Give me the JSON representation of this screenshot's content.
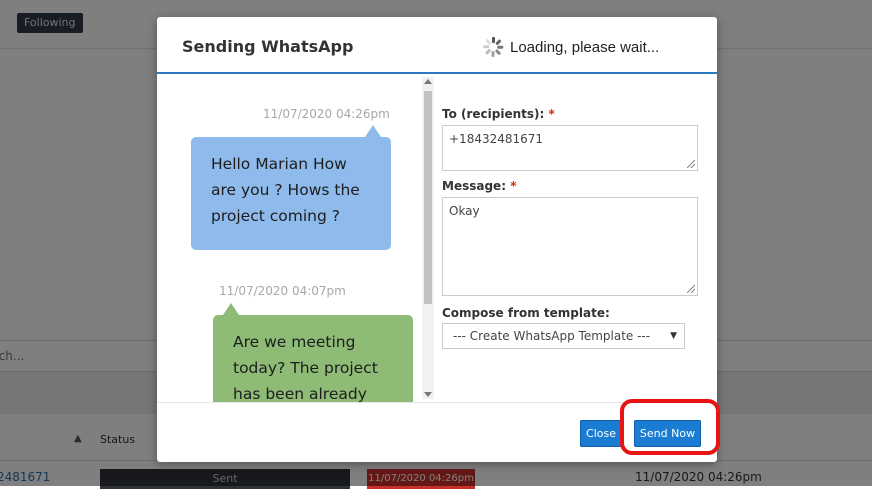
{
  "background": {
    "following_label": "Following",
    "search_placeholder": "rch...",
    "status_header": "Status",
    "row": {
      "phone": "2481671",
      "status": "Sent",
      "date_badge": "11/07/2020 04:26pm",
      "date": "11/07/2020 04:26pm"
    }
  },
  "modal": {
    "title": "Sending WhatsApp",
    "loading_text": "Loading, please wait...",
    "chat": [
      {
        "timestamp": "11/07/2020 04:26pm",
        "text": "Hello Marian How are you ? Hows the project coming ?",
        "color": "#8fbbec"
      },
      {
        "timestamp": "11/07/2020 04:07pm",
        "text": "Are we meeting today? The project has been already",
        "color": "#8ebb75"
      }
    ],
    "form": {
      "to_label": "To (recipients):",
      "to_value": "+18432481671",
      "message_label": "Message:",
      "message_value": "Okay",
      "template_label": "Compose from template:",
      "template_selected": "--- Create WhatsApp Template ---",
      "required_mark": "*"
    },
    "footer": {
      "close_label": "Close",
      "send_label": "Send Now"
    }
  },
  "colors": {
    "accent": "#1a7cd3",
    "highlight": "#e81414",
    "header_rule": "#2b79c2"
  }
}
